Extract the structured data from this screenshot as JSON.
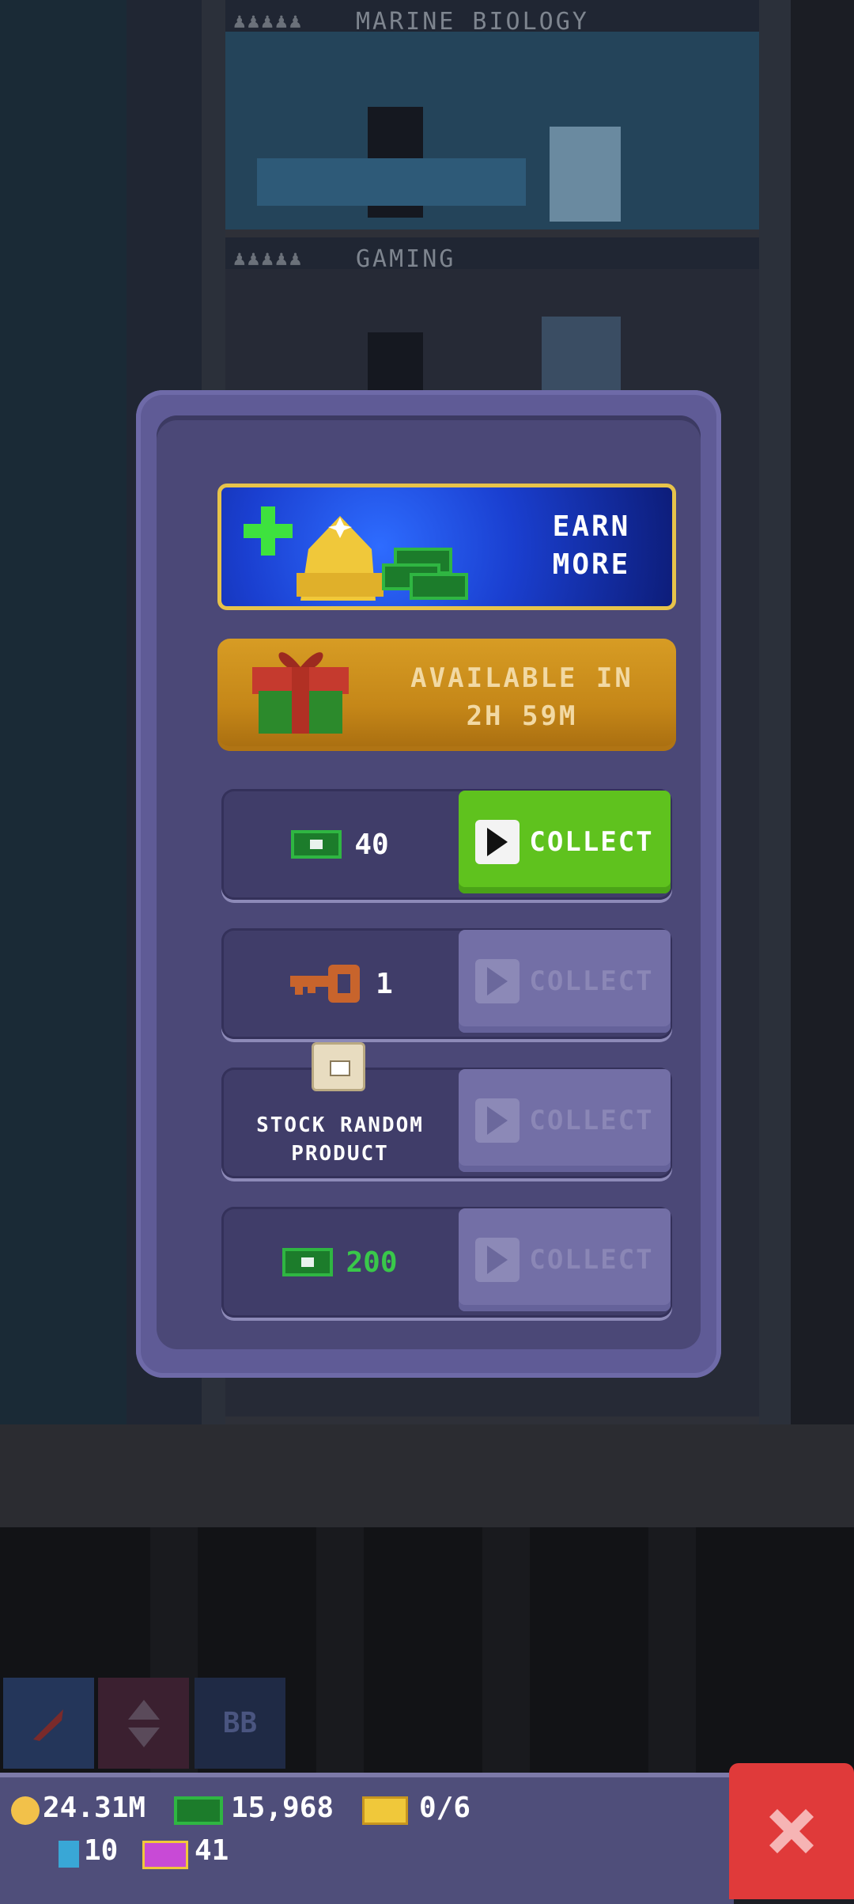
{
  "background": {
    "floors": [
      {
        "label": "MARINE BIOLOGY"
      },
      {
        "label": "GAMING"
      }
    ]
  },
  "modal": {
    "earn_more": {
      "label_line1": "EARN",
      "label_line2": "MORE"
    },
    "gift": {
      "label_line1": "AVAILABLE IN",
      "label_line2": "2H 59M"
    },
    "rewards": [
      {
        "icon": "cash-icon",
        "value": "40",
        "button": "COLLECT",
        "enabled": true
      },
      {
        "icon": "key-icon",
        "value": "1",
        "button": "COLLECT",
        "enabled": false
      },
      {
        "icon": "box-icon",
        "label_line1": "STOCK RANDOM",
        "label_line2": "PRODUCT",
        "button": "COLLECT",
        "enabled": false
      },
      {
        "icon": "cash-icon",
        "value": "200",
        "button": "COLLECT",
        "enabled": false
      }
    ]
  },
  "status_bar": {
    "coins": "24.31M",
    "bux": "15,968",
    "tickets": "0/6",
    "keys": "10",
    "golden_tickets": "41"
  },
  "colors": {
    "modal_bg": "#5f5b96",
    "collect_active": "#5fc21e",
    "collect_disabled": "#736fa6",
    "close_button": "#e03a3a"
  }
}
